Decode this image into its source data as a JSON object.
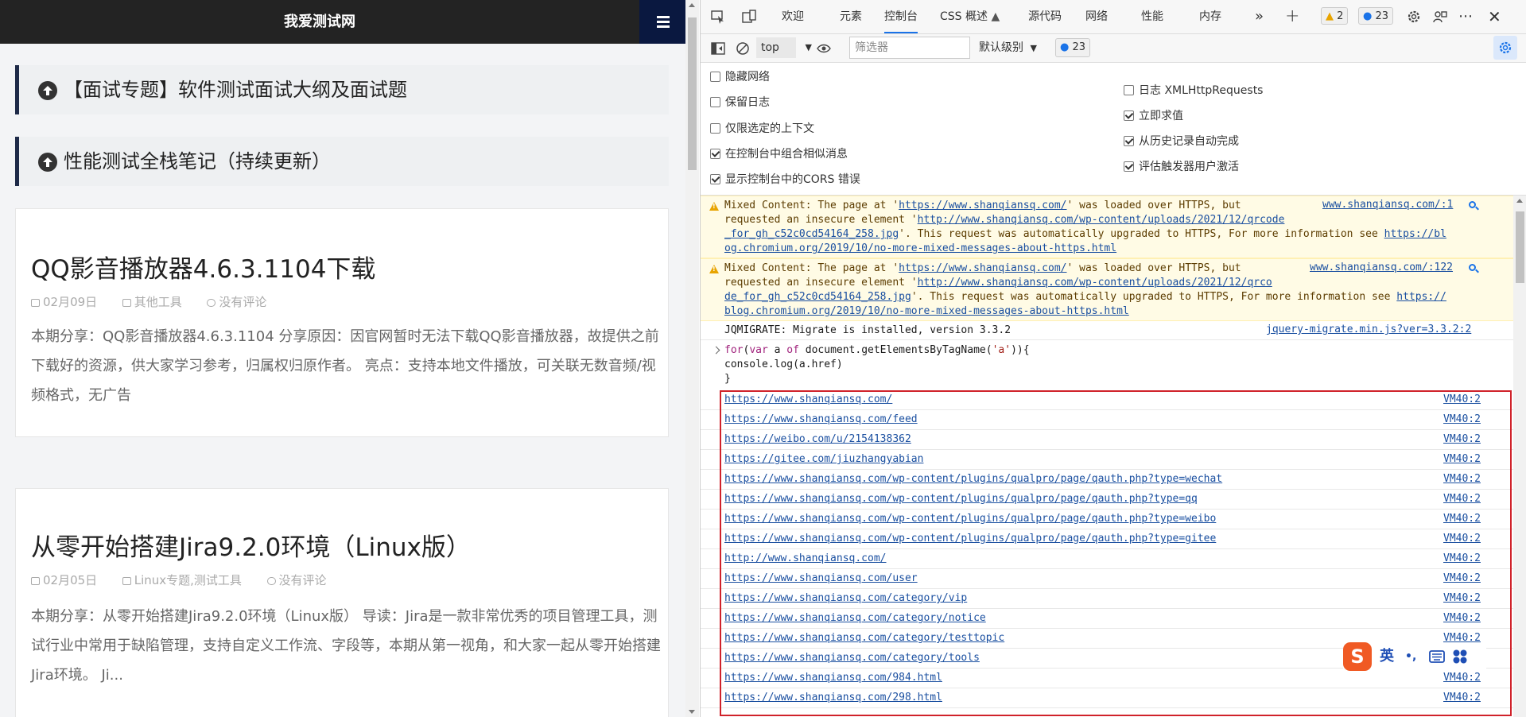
{
  "site": {
    "title": "我爱测试网",
    "topics": [
      "【面试专题】软件测试面试大纲及面试题",
      "性能测试全栈笔记（持续更新）"
    ],
    "posts": [
      {
        "title": "QQ影音播放器4.6.3.1104下载",
        "date": "02月09日",
        "category": "其他工具",
        "comments": "没有评论",
        "excerpt": "本期分享：QQ影音播放器4.6.3.1104 分享原因：因官网暂时无法下载QQ影音播放器，故提供之前下载好的资源，供大家学习参考，归属权归原作者。 亮点：支持本地文件播放，可关联无数音频/视频格式，无广告"
      },
      {
        "title": "从零开始搭建Jira9.2.0环境（Linux版）",
        "date": "02月05日",
        "category": "Linux专题,测试工具",
        "comments": "没有评论",
        "excerpt": "本期分享：从零开始搭建Jira9.2.0环境（Linux版） 导读：Jira是一款非常优秀的项目管理工具，测试行业中常用于缺陷管理，支持自定义工作流、字段等，本期从第一视角，和大家一起从零开始搭建Jira环境。 Ji..."
      }
    ]
  },
  "devtools": {
    "tabs": [
      "欢迎",
      "元素",
      "控制台",
      "CSS 概述",
      "源代码",
      "网络",
      "性能",
      "内存"
    ],
    "active_tab": "控制台",
    "warn_count": "2",
    "msg_count": "23",
    "toolbar": {
      "context": "top",
      "filter_placeholder": "筛选器",
      "level": "默认级别",
      "msg_count": "23"
    },
    "settings_left": [
      {
        "label": "隐藏网络",
        "checked": false
      },
      {
        "label": "保留日志",
        "checked": false
      },
      {
        "label": "仅限选定的上下文",
        "checked": false
      },
      {
        "label": "在控制台中组合相似消息",
        "checked": true
      },
      {
        "label": "显示控制台中的CORS 错误",
        "checked": true
      }
    ],
    "settings_right": [
      {
        "label": "日志 XMLHttpRequests",
        "checked": false
      },
      {
        "label": "立即求值",
        "checked": true
      },
      {
        "label": "从历史记录自动完成",
        "checked": true
      },
      {
        "label": "评估触发器用户激活",
        "checked": true
      }
    ],
    "warnings": [
      {
        "line1_pre": "Mixed Content: The page at '",
        "line1_link": "https://www.shanqiansq.com/",
        "line1_post": "' was loaded over HTTPS, but",
        "line2_pre": "requested an insecure element '",
        "line2_link": "http://www.shanqiansq.com/wp-content/uploads/2021/12/qrcode",
        "line3_link": "_for_gh_c52c0cd54164_258.jpg",
        "line3_post": "'. This request was automatically upgraded to HTTPS, For more information see ",
        "line3_link2": "https://bl",
        "line4_link": "og.chromium.org/2019/10/no-more-mixed-messages-about-https.html",
        "source": "www.shanqiansq.com/:1"
      },
      {
        "line1_pre": "Mixed Content: The page at '",
        "line1_link": "https://www.shanqiansq.com/",
        "line1_post": "' was loaded over HTTPS, but",
        "line2_pre": "requested an insecure element '",
        "line2_link": "http://www.shanqiansq.com/wp-content/uploads/2021/12/qrco",
        "line3_link": "de_for_gh_c52c0cd54164_258.jpg",
        "line3_post": "'. This request was automatically upgraded to HTTPS, For more information see ",
        "line3_link2": "https://",
        "line4_link": "blog.chromium.org/2019/10/no-more-mixed-messages-about-https.html",
        "source": "www.shanqiansq.com/:122"
      }
    ],
    "info": {
      "text": "JQMIGRATE: Migrate is installed, version 3.3.2",
      "source": "jquery-migrate.min.js?ver=3.3.2:2"
    },
    "command": {
      "l1_kw1": "for",
      "l1_a": "(",
      "l1_kw2": "var",
      "l1_b": " a ",
      "l1_kw3": "of",
      "l1_c": " document.getElementsByTagName(",
      "l1_str": "'a'",
      "l1_d": ")){",
      "l2": "console.log(a.href)",
      "l3": "}"
    },
    "links": [
      "https://www.shanqiansq.com/",
      "https://www.shanqiansq.com/feed",
      "https://weibo.com/u/2154138362",
      "https://gitee.com/jiuzhangyabian",
      "https://www.shanqiansq.com/wp-content/plugins/qualpro/page/qauth.php?type=wechat",
      "https://www.shanqiansq.com/wp-content/plugins/qualpro/page/qauth.php?type=qq",
      "https://www.shanqiansq.com/wp-content/plugins/qualpro/page/qauth.php?type=weibo",
      "https://www.shanqiansq.com/wp-content/plugins/qualpro/page/qauth.php?type=gitee",
      "http://www.shanqiansq.com/",
      "https://www.shanqiansq.com/user",
      "https://www.shanqiansq.com/category/vip",
      "https://www.shanqiansq.com/category/notice",
      "https://www.shanqiansq.com/category/testtopic",
      "https://www.shanqiansq.com/category/tools",
      "https://www.shanqiansq.com/984.html",
      "https://www.shanqiansq.com/298.html"
    ],
    "link_source": "VM40:2"
  },
  "ime": {
    "logo": "S",
    "lang": "英",
    "punct": "•,"
  },
  "colors": {
    "accent": "#1a73e8",
    "header_bg": "#232323",
    "menu_bg": "#0a1840",
    "highlight_border": "#d0222a",
    "warning_bg": "#fffbe5"
  }
}
